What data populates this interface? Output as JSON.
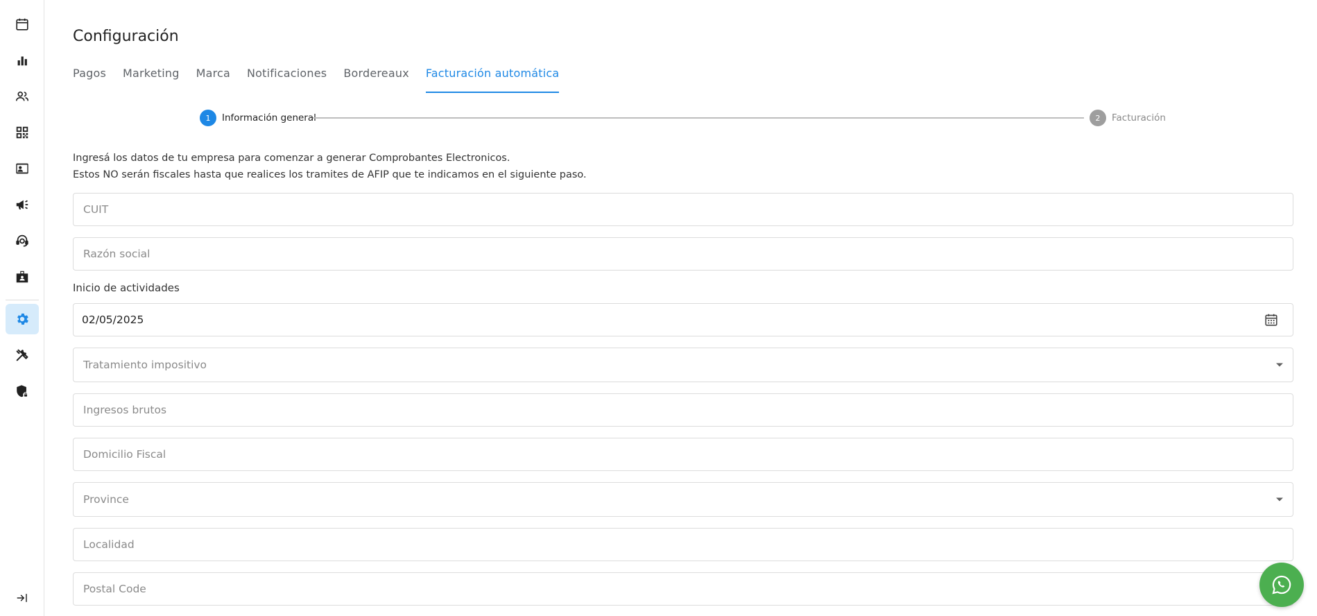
{
  "page": {
    "title": "Configuración"
  },
  "tabs": [
    {
      "label": "Pagos"
    },
    {
      "label": "Marketing"
    },
    {
      "label": "Marca"
    },
    {
      "label": "Notificaciones"
    },
    {
      "label": "Bordereaux"
    },
    {
      "label": "Facturación automática"
    }
  ],
  "active_tab": "Facturación automática",
  "stepper": {
    "steps": [
      {
        "number": "1",
        "label": "Información general",
        "state": "active"
      },
      {
        "number": "2",
        "label": "Facturación",
        "state": "inactive"
      }
    ]
  },
  "intro": {
    "line1": "Ingresá los datos de tu empresa para comenzar a generar Comprobantes Electronicos.",
    "line2": "Estos NO serán fiscales hasta que realices los tramites de AFIP que te indicamos en el siguiente paso."
  },
  "form": {
    "cuit": {
      "placeholder": "CUIT"
    },
    "razon_social": {
      "placeholder": "Razón social"
    },
    "inicio_label": "Inicio de actividades",
    "inicio_value": "02/05/2025",
    "tratamiento": {
      "placeholder": "Tratamiento impositivo"
    },
    "ingresos": {
      "placeholder": "Ingresos brutos"
    },
    "domicilio": {
      "placeholder": "Domicilio Fiscal"
    },
    "province": {
      "placeholder": "Province"
    },
    "localidad": {
      "placeholder": "Localidad"
    },
    "postal_code": {
      "placeholder": "Postal Code"
    }
  },
  "sidebar": {
    "items": [
      {
        "icon": "calendar-icon"
      },
      {
        "icon": "bar-chart-icon"
      },
      {
        "icon": "users-icon"
      },
      {
        "icon": "qr-code-icon"
      },
      {
        "icon": "contact-card-icon"
      },
      {
        "icon": "megaphone-icon"
      },
      {
        "icon": "support-agent-icon"
      },
      {
        "icon": "badge-icon"
      },
      {
        "icon": "gear-icon",
        "active": true
      },
      {
        "icon": "tools-icon"
      },
      {
        "icon": "shield-lock-icon"
      }
    ],
    "collapse_icon": "collapse-arrow-icon"
  },
  "colors": {
    "accent": "#1e88e5",
    "active_nav_bg": "#d6ebfb",
    "whatsapp": "#4caf50",
    "border": "#dcdcdc"
  },
  "fab": {
    "icon": "whatsapp-icon"
  }
}
